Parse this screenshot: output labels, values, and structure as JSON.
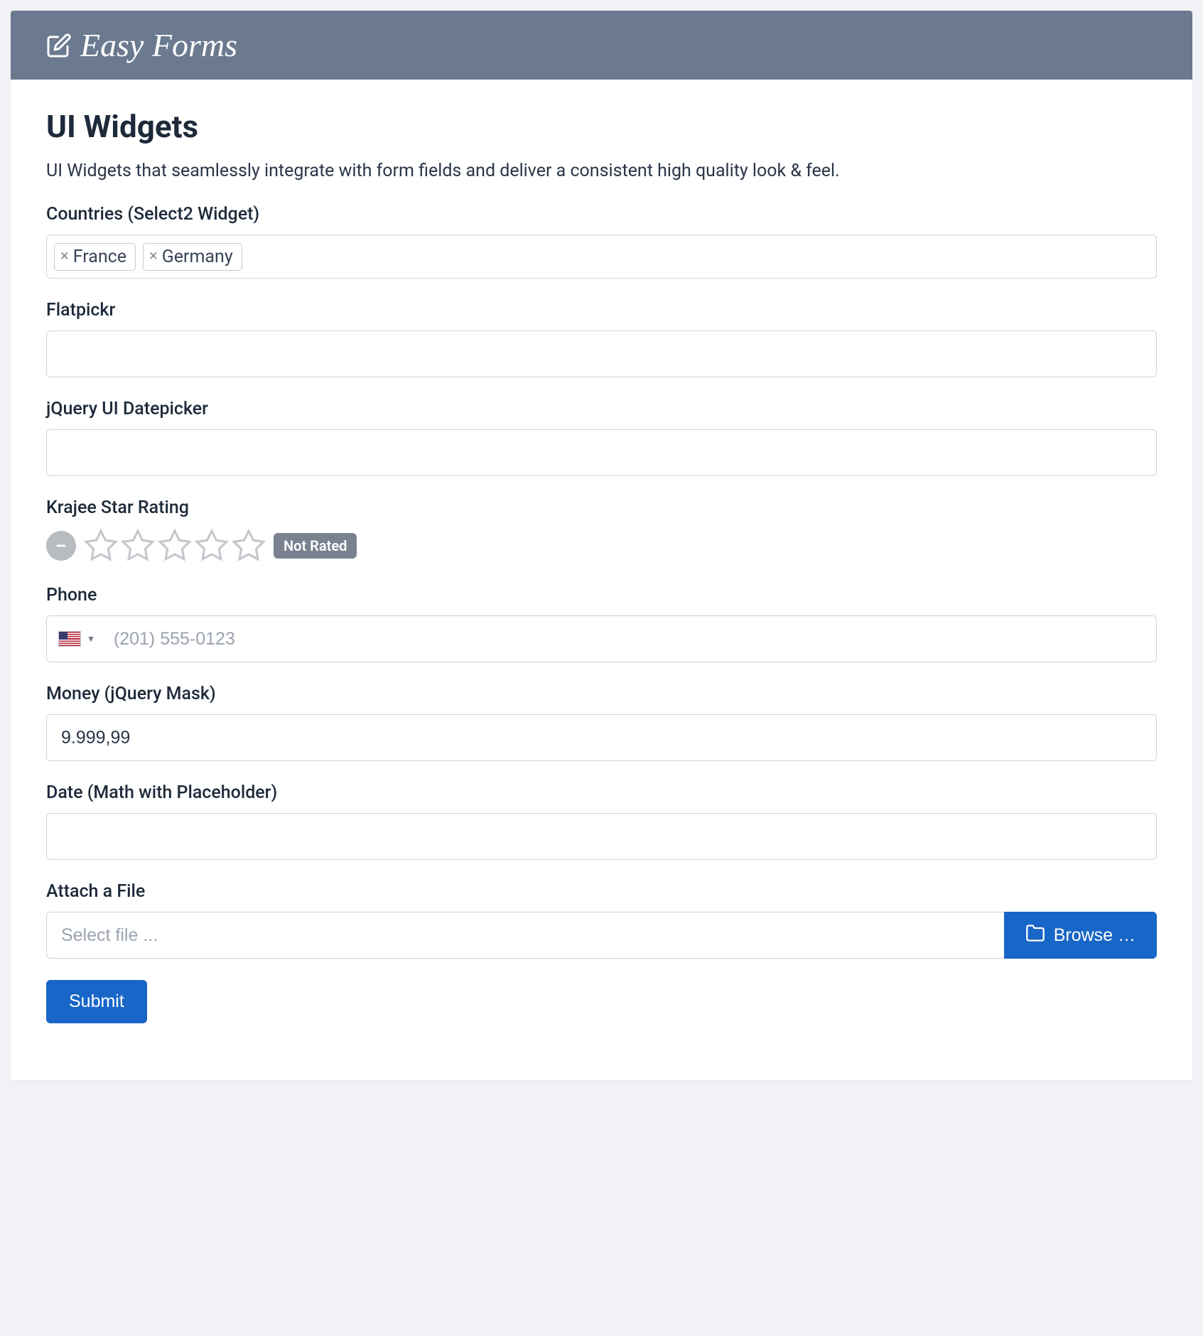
{
  "header": {
    "title": "Easy Forms"
  },
  "page": {
    "title": "UI Widgets",
    "description": "UI Widgets that seamlessly integrate with form fields and deliver a consistent high quality look & feel."
  },
  "fields": {
    "countries": {
      "label": "Countries (Select2 Widget)",
      "tags": [
        "France",
        "Germany"
      ]
    },
    "flatpickr": {
      "label": "Flatpickr",
      "value": ""
    },
    "jqdatepicker": {
      "label": "jQuery UI Datepicker",
      "value": ""
    },
    "rating": {
      "label": "Krajee Star Rating",
      "badge": "Not Rated"
    },
    "phone": {
      "label": "Phone",
      "placeholder": "(201) 555-0123",
      "value": ""
    },
    "money": {
      "label": "Money (jQuery Mask)",
      "value": "9.999,99"
    },
    "datemath": {
      "label": "Date (Math with Placeholder)",
      "value": ""
    },
    "file": {
      "label": "Attach a File",
      "placeholder": "Select file ...",
      "browse": "Browse …"
    }
  },
  "actions": {
    "submit": "Submit"
  }
}
